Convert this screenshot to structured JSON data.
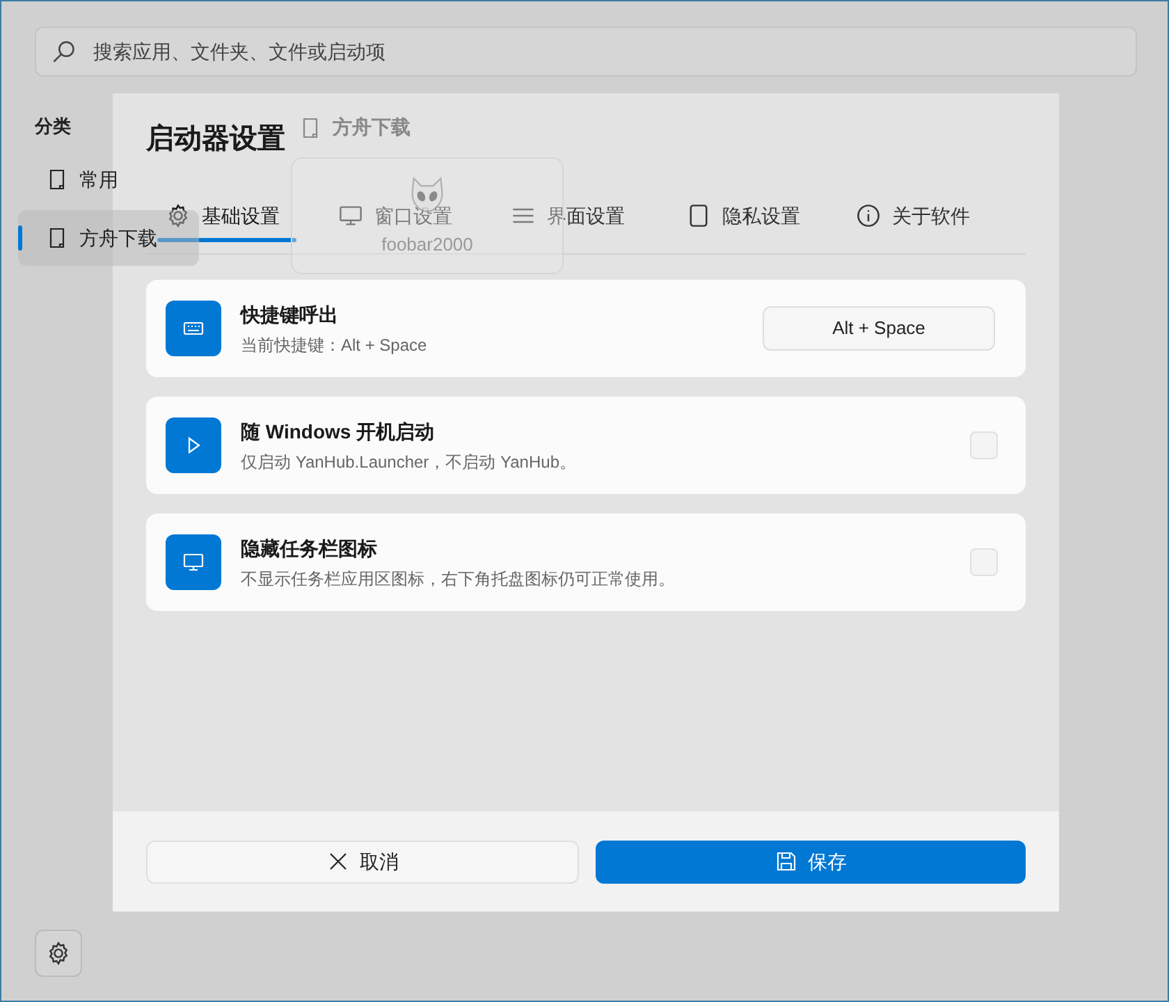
{
  "search": {
    "placeholder": "搜索应用、文件夹、文件或启动项"
  },
  "sidebar": {
    "heading": "分类",
    "items": [
      {
        "label": "常用",
        "selected": false
      },
      {
        "label": "方舟下载",
        "selected": true
      }
    ]
  },
  "dialog": {
    "title": "启动器设置",
    "tabs": [
      {
        "label": "基础设置",
        "selected": true
      },
      {
        "label": "窗口设置",
        "selected": false
      },
      {
        "label": "界面设置",
        "selected": false
      },
      {
        "label": "隐私设置",
        "selected": false
      },
      {
        "label": "关于软件",
        "selected": false
      }
    ],
    "settings": [
      {
        "kind": "shortcut",
        "title": "快捷键呼出",
        "description": "当前快捷键：Alt + Space",
        "value": "Alt + Space"
      },
      {
        "kind": "checkbox",
        "title": "随 Windows 开机启动",
        "description": "仅启动 YanHub.Launcher，不启动 YanHub。",
        "checked": false
      },
      {
        "kind": "checkbox",
        "title": "隐藏任务栏图标",
        "description": "不显示任务栏应用区图标，右下角托盘图标仍可正常使用。",
        "checked": false
      }
    ],
    "buttons": [
      {
        "kind": "cancel",
        "label": "取消"
      },
      {
        "kind": "save",
        "label": "保存"
      }
    ]
  },
  "drag_preview": {
    "category": "方舟下载",
    "app": "foobar2000"
  }
}
